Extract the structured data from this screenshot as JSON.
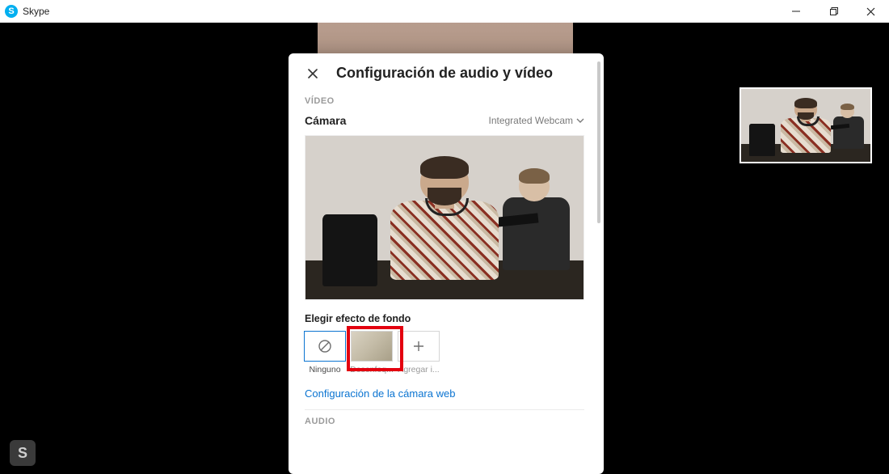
{
  "window": {
    "title": "Skype"
  },
  "dialog": {
    "title": "Configuración de audio y vídeo",
    "video_section": "VÍDEO",
    "camera_label": "Cámara",
    "camera_device": "Integrated Webcam",
    "effects_label": "Elegir efecto de fondo",
    "effects": {
      "none": "Ninguno",
      "blur": "Desenfoq...",
      "add": "Agregar i..."
    },
    "webcam_settings_link": "Configuración de la cámara web",
    "audio_section": "AUDIO"
  }
}
